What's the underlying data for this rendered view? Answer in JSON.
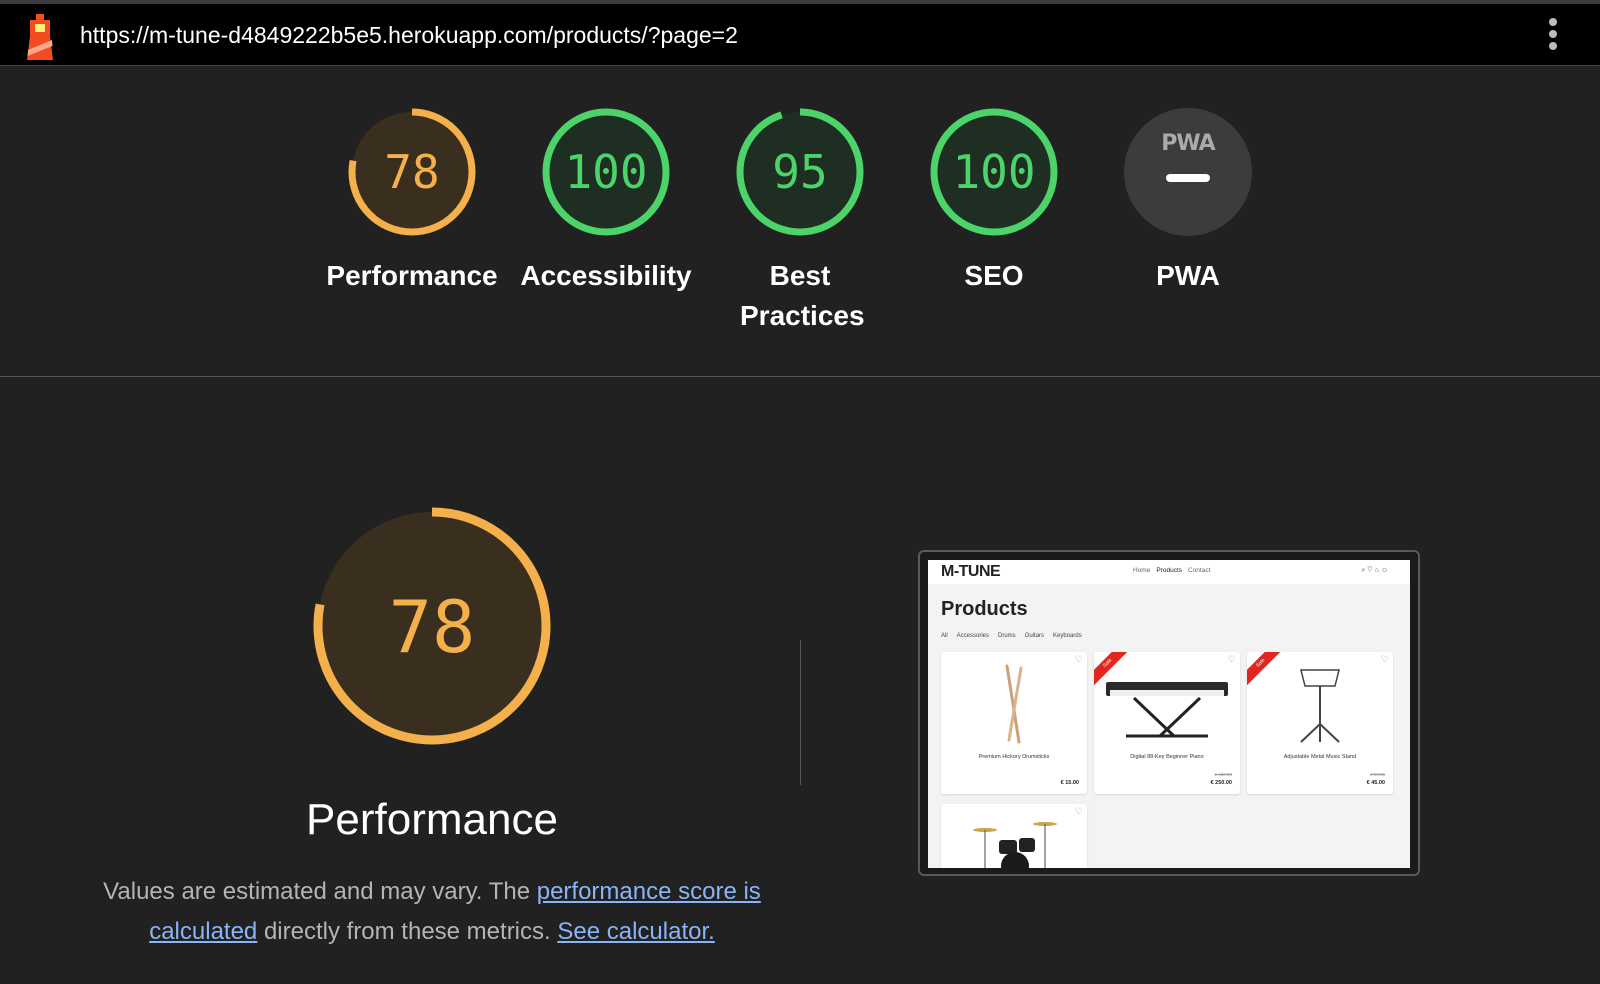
{
  "url": "https://m-tune-d4849222b5e5.herokuapp.com/products/?page=2",
  "colors": {
    "average": "#f4b04a",
    "pass": "#4cd46a",
    "na": "#3c3c3c"
  },
  "categories": [
    {
      "label": "Performance",
      "score": "78",
      "status": "average"
    },
    {
      "label": "Accessibility",
      "score": "100",
      "status": "pass"
    },
    {
      "label": "Best Practices",
      "score": "95",
      "status": "pass"
    },
    {
      "label": "SEO",
      "score": "100",
      "status": "pass"
    },
    {
      "label": "PWA",
      "score": "",
      "badge": "PWA",
      "status": "na"
    }
  ],
  "performance": {
    "score": "78",
    "title": "Performance",
    "desc_prefix": "Values are estimated and may vary. The ",
    "link_score": "performance score is calculated",
    "desc_middle": " directly from these metrics. ",
    "link_calc": "See calculator."
  },
  "screenshot": {
    "logo": "M-TUNE",
    "nav": [
      "Home",
      "Products",
      "Contact"
    ],
    "heading": "Products",
    "categories": [
      "All",
      "Accessories",
      "Drums",
      "Guitars",
      "Keyboards"
    ],
    "products": [
      {
        "name": "Premium Hickory Drumsticks",
        "price": "€ 15.00",
        "old_price": "",
        "sale": false
      },
      {
        "name": "Digital 88-Key Beginner Piano",
        "price": "€ 250.00",
        "old_price": "€ 450.00",
        "sale": true
      },
      {
        "name": "Adjustable Metal Music Stand",
        "price": "€ 45.00",
        "old_price": "€ 90.00",
        "sale": true
      },
      {
        "name": "",
        "price": "",
        "old_price": "",
        "sale": false
      }
    ]
  }
}
